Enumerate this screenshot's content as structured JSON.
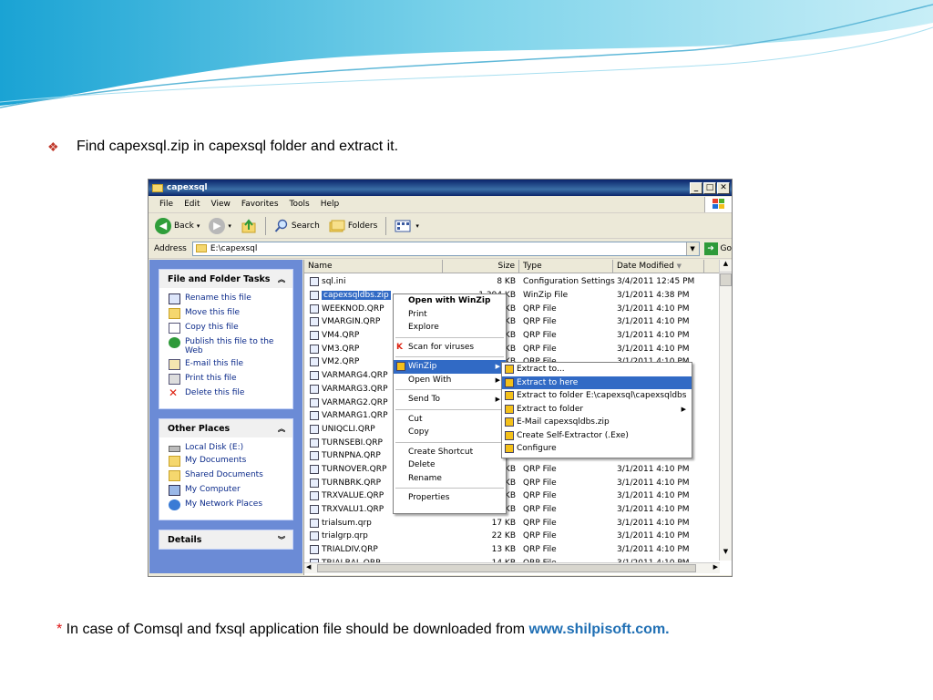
{
  "slide": {
    "bullet_text": "Find capexsql.zip in capexsql folder and extract it.",
    "footnote_star": "*",
    "footnote_text": " In case of Comsql and fxsql application file should be downloaded from ",
    "footnote_link": "www.shilpisoft.com."
  },
  "window": {
    "title": "capexsql",
    "menu": [
      "File",
      "Edit",
      "View",
      "Favorites",
      "Tools",
      "Help"
    ],
    "toolbar": {
      "back": "Back",
      "search": "Search",
      "folders": "Folders"
    },
    "address_label": "Address",
    "address_value": "E:\\capexsql",
    "go_label": "Go"
  },
  "taskpane": {
    "file_tasks_title": "File and Folder Tasks",
    "file_tasks": [
      "Rename this file",
      "Move this file",
      "Copy this file",
      "Publish this file to the Web",
      "E-mail this file",
      "Print this file",
      "Delete this file"
    ],
    "other_places_title": "Other Places",
    "other_places": [
      "Local Disk (E:)",
      "My Documents",
      "Shared Documents",
      "My Computer",
      "My Network Places"
    ],
    "details_title": "Details"
  },
  "filelist": {
    "columns": {
      "name": "Name",
      "size": "Size",
      "type": "Type",
      "date": "Date Modified"
    },
    "rows": [
      {
        "name": "sql.ini",
        "size": "8 KB",
        "type": "Configuration Settings",
        "date": "3/4/2011 12:45 PM"
      },
      {
        "name": "capexsqldbs.zip",
        "size": "1,394 KB",
        "type": "WinZip File",
        "date": "3/1/2011 4:38 PM"
      },
      {
        "name": "WEEKNOD.QRP",
        "size": "9 KB",
        "type": "QRP File",
        "date": "3/1/2011 4:10 PM"
      },
      {
        "name": "VMARGIN.QRP",
        "size": "9 KB",
        "type": "QRP File",
        "date": "3/1/2011 4:10 PM"
      },
      {
        "name": "VM4.QRP",
        "size": "16 KB",
        "type": "QRP File",
        "date": "3/1/2011 4:10 PM"
      },
      {
        "name": "VM3.QRP",
        "size": "17 KB",
        "type": "QRP File",
        "date": "3/1/2011 4:10 PM"
      },
      {
        "name": "VM2.QRP",
        "size": "16 KB",
        "type": "QRP File",
        "date": "3/1/2011 4:10 PM"
      },
      {
        "name": "VARMARG4.QRP",
        "size": "",
        "type": "",
        "date": ""
      },
      {
        "name": "VARMARG3.QRP",
        "size": "",
        "type": "",
        "date": ""
      },
      {
        "name": "VARMARG2.QRP",
        "size": "",
        "type": "",
        "date": ""
      },
      {
        "name": "VARMARG1.QRP",
        "size": "",
        "type": "",
        "date": ""
      },
      {
        "name": "UNIQCLI.QRP",
        "size": "",
        "type": "",
        "date": ""
      },
      {
        "name": "TURNSEBI.QRP",
        "size": "",
        "type": "",
        "date": ""
      },
      {
        "name": "TURNPNA.QRP",
        "size": "",
        "type": "",
        "date": ""
      },
      {
        "name": "TURNOVER.QRP",
        "size": "13 KB",
        "type": "QRP File",
        "date": "3/1/2011 4:10 PM"
      },
      {
        "name": "TURNBRK.QRP",
        "size": "11 KB",
        "type": "QRP File",
        "date": "3/1/2011 4:10 PM"
      },
      {
        "name": "TRXVALUE.QRP",
        "size": "15 KB",
        "type": "QRP File",
        "date": "3/1/2011 4:10 PM"
      },
      {
        "name": "TRXVALU1.QRP",
        "size": "13 KB",
        "type": "QRP File",
        "date": "3/1/2011 4:10 PM"
      },
      {
        "name": "trialsum.qrp",
        "size": "17 KB",
        "type": "QRP File",
        "date": "3/1/2011 4:10 PM"
      },
      {
        "name": "trialgrp.qrp",
        "size": "22 KB",
        "type": "QRP File",
        "date": "3/1/2011 4:10 PM"
      },
      {
        "name": "TRIALDIV.QRP",
        "size": "13 KB",
        "type": "QRP File",
        "date": "3/1/2011 4:10 PM"
      },
      {
        "name": "TRIALBAL.QRP",
        "size": "14 KB",
        "type": "QRP File",
        "date": "3/1/2011 4:10 PM"
      }
    ]
  },
  "context_menu": {
    "open_winzip": "Open with WinZip",
    "print": "Print",
    "explore": "Explore",
    "scan": "Scan for viruses",
    "winzip": "WinZip",
    "open_with": "Open With",
    "send_to": "Send To",
    "cut": "Cut",
    "copy": "Copy",
    "create_shortcut": "Create Shortcut",
    "delete": "Delete",
    "rename": "Rename",
    "properties": "Properties"
  },
  "winzip_menu": {
    "extract_to": "Extract to...",
    "extract_here": "Extract to here",
    "extract_folder_path": "Extract to folder E:\\capexsql\\capexsqldbs",
    "extract_folder": "Extract to folder",
    "email": "E-Mail capexsqldbs.zip",
    "self_extractor": "Create Self-Extractor (.Exe)",
    "configure": "Configure"
  },
  "colors": {
    "selection": "#316ac5",
    "title_bar": "#0a246a",
    "task_pane": "#6b8bd6",
    "link": "#1f6fb4"
  }
}
